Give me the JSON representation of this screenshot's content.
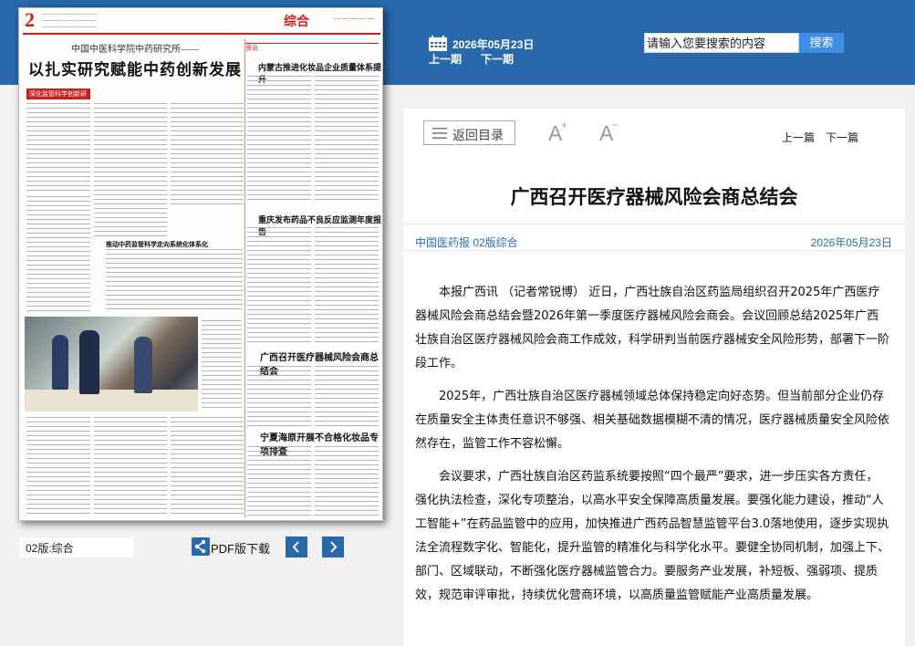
{
  "header": {
    "date": "2026年05月23日",
    "prev_label": "上一期",
    "next_label": "下一期",
    "search_placeholder": "请输入您要搜索的内容",
    "search_button": "搜索",
    "colors": {
      "band": "#2a68ac",
      "search_button": "#3e8ee5"
    }
  },
  "newspaper": {
    "page_number": "2",
    "section": "综合",
    "lead_subtitle": "中国中医科学院中药研究所——",
    "lead_title": "以扎实研究赋能中药创新发展",
    "side_headline": "内蒙古推进化妆品企业质量体系提升",
    "mid_headline": "重庆发布药品不良反应监测年度报告",
    "feature_headline": "广西召开医疗器械风险会商总结会",
    "bottom_headline": "宁夏海原开展不合格化妆品专项排查",
    "box_label": "资讯",
    "tag_label": "深化监管科学创新研究",
    "col_headline": "推动中药监管科学走向系统化体系化",
    "accent_color": "#c8201f"
  },
  "controls": {
    "page_select": "02版:综合",
    "pdf_label": "PDF版下载",
    "pdf_icon": "share-icon",
    "prev_page_icon": "chevron-left-icon",
    "next_page_icon": "chevron-right-icon"
  },
  "article": {
    "back_label": "返回目录",
    "font_increase_icon": "font-increase-icon",
    "font_decrease_icon": "font-decrease-icon",
    "prev_article": "上一篇",
    "next_article": "下一篇",
    "title": "广西召开医疗器械风险会商总结会",
    "source": "中国医药报 02版综合",
    "date": "2026年05月23日",
    "paragraphs": [
      "本报广西讯 （记者常锐博） 近日，广西壮族自治区药监局组织召开2025年广西医疗器械风险会商总结会暨2026年第一季度医疗器械风险会商会。会议回顾总结2025年广西壮族自治区医疗器械风险会商工作成效，科学研判当前医疗器械安全风险形势，部署下一阶段工作。",
      "2025年，广西壮族自治区医疗器械领域总体保持稳定向好态势。但当前部分企业仍存在质量安全主体责任意识不够强、相关基础数据模糊不清的情况，医疗器械质量安全风险依然存在，监管工作不容松懈。",
      "会议要求，广西壮族自治区药监系统要按照“四个最严”要求，进一步压实各方责任，强化执法检查，深化专项整治，以高水平安全保障高质量发展。要强化能力建设，推动“人工智能+”在药品监管中的应用，加快推进广西药品智慧监管平台3.0落地使用，逐步实现执法全流程数字化、智能化，提升监管的精准化与科学化水平。要健全协同机制，加强上下、部门、区域联动，不断强化医疗器械监管合力。要服务产业发展，补短板、强弱项、提质效，规范审评审批，持续优化营商环境，以高质量监管赋能产业高质量发展。"
    ]
  }
}
